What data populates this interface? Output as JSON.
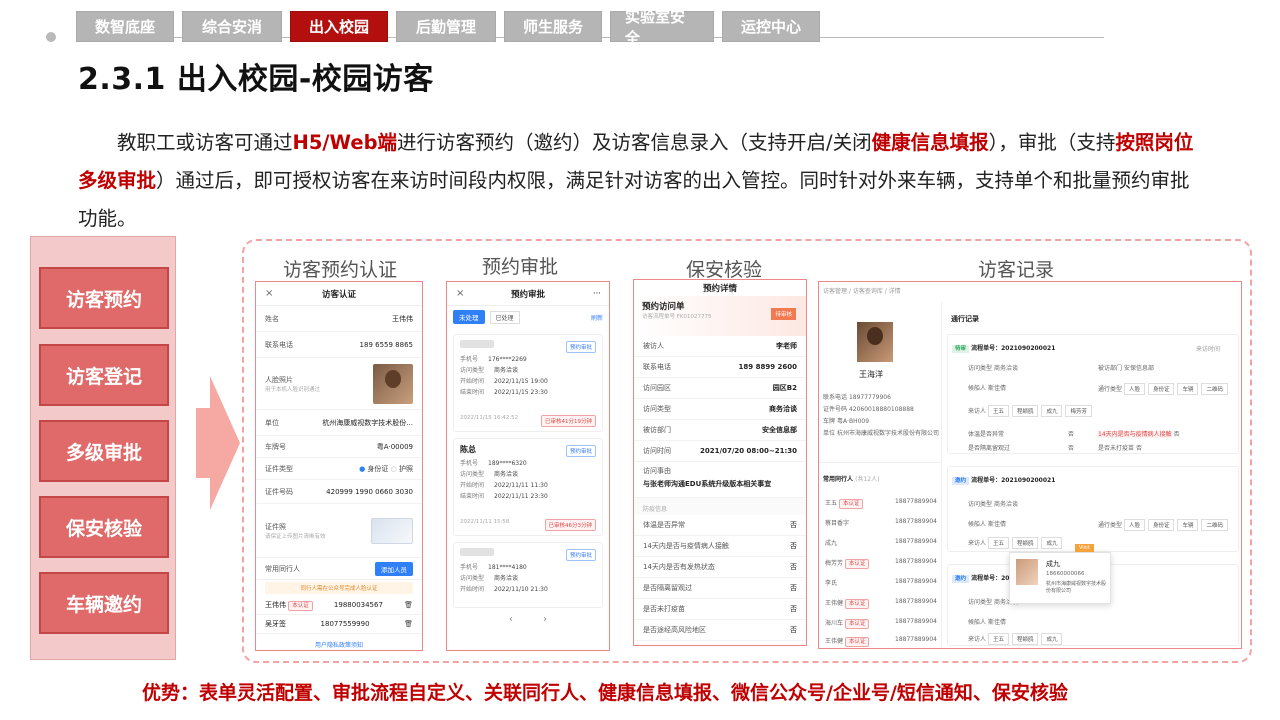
{
  "nav": {
    "tabs": [
      {
        "label": "数智底座",
        "active": false
      },
      {
        "label": "综合安消",
        "active": false
      },
      {
        "label": "出入校园",
        "active": true
      },
      {
        "label": "后勤管理",
        "active": false
      },
      {
        "label": "师生服务",
        "active": false
      },
      {
        "label": "实验室安全",
        "active": false
      },
      {
        "label": "运控中心",
        "active": false
      }
    ]
  },
  "page_title": "2.3.1 出入校园-校园访客",
  "intro": {
    "p1": "教职工或访客可通过",
    "h1": "H5/Web端",
    "p2": "进行访客预约（邀约）及访客信息录入（支持开启/关闭",
    "h2": "健康信息填报",
    "p3": "），审批（支持",
    "h3": "按照岗位多级审批",
    "p4": "）通过后，即可授权访客在来访时间段内权限，满足针对访客的出入管控。同时针对外来车辆，支持单个和批量预约审批功能。"
  },
  "sidebar": {
    "items": [
      "访客预约",
      "访客登记",
      "多级审批",
      "保安核验",
      "车辆邀约"
    ]
  },
  "columns": {
    "auth": "访客预约认证",
    "approval": "预约审批",
    "guard": "保安核验",
    "records": "访客记录"
  },
  "auth_card": {
    "header": "访客认证",
    "close": "×",
    "name_k": "姓名",
    "name_v": "王伟伟",
    "phone_k": "联系电话",
    "phone_v": "189 6559 8865",
    "face_k": "人脸照片",
    "face_sub": "用于本机人脸识别通过",
    "unit_k": "单位",
    "unit_v": "杭州海康威视数字技术股份...",
    "plate_k": "车牌号",
    "plate_v": "粤A·00009",
    "cert_k": "证件类型",
    "cert_opt1": "身份证",
    "cert_opt2": "护照",
    "certno_k": "证件号码",
    "certno_v": "420999 1990 0660 3030",
    "certimg_k": "证件照",
    "certimg_sub": "请保证上传图片清晰有效",
    "companions_k": "常用同行人",
    "add_btn": "添加人员",
    "notice": "同行人需在公众号完成人脸认证",
    "comp1_name": "王伟伟",
    "comp1_tag": "本认证",
    "comp1_phone": "19880034567",
    "comp2_name": "吴牙签",
    "comp2_phone": "18077559990",
    "footer_link": "用户隐私政策须知"
  },
  "approval_card": {
    "header": "预约审批",
    "more": "···",
    "filter_pending": "未处理",
    "filter_done": "已处理",
    "refresh": "刷新",
    "items": [
      {
        "name": "",
        "status": "预约审批",
        "phone": "176****2269",
        "type": "商务洽谈",
        "start": "2022/11/15 19:00",
        "end": "2022/11/15 23:30",
        "created": "2022/11/15 16:42:52",
        "remain": "已审核41分19分钟"
      },
      {
        "name": "陈总",
        "status": "预约审批",
        "phone": "189****6320",
        "type": "商务洽谈",
        "start": "2022/11/11 11:30",
        "end": "2022/11/11 23:30",
        "created": "2022/11/11 15:58",
        "remain": "已审核46分3分钟"
      },
      {
        "name": "",
        "status": "预约审批",
        "phone": "181****4180",
        "type": "商务洽谈",
        "start": "2022/11/10 21:30",
        "end": "",
        "created": "",
        "remain": ""
      }
    ],
    "labels": {
      "phone": "手机号",
      "type": "访问类型",
      "start": "开始时间",
      "end": "结束时间"
    },
    "prev": "‹",
    "next": "›"
  },
  "guard_card": {
    "header": "预约详情",
    "title": "预约访问单",
    "sub": "访客流程单号 FK01027775",
    "stamp": "待审核",
    "rows": [
      {
        "k": "被访人",
        "v": "李老师"
      },
      {
        "k": "联系电话",
        "v": "189 8899 2600"
      },
      {
        "k": "访问园区",
        "v": "园区B2"
      },
      {
        "k": "访问类型",
        "v": "商务洽谈"
      },
      {
        "k": "被访部门",
        "v": "安全信息部"
      },
      {
        "k": "访问时间",
        "v": "2021/07/20  08:00~21:30"
      }
    ],
    "reason_k": "访问事由",
    "reason_v": "与张老师沟通EDU系统升级版本相关事宜",
    "health_title": "防疫信息",
    "health": [
      {
        "k": "体温是否异常",
        "v": "否"
      },
      {
        "k": "14天内是否与疫情病人接触",
        "v": "否"
      },
      {
        "k": "14天内是否有发热状态",
        "v": "否"
      },
      {
        "k": "是否隔离留观过",
        "v": "否"
      },
      {
        "k": "是否未打疫苗",
        "v": "否"
      },
      {
        "k": "是否途经高风险地区",
        "v": "否"
      }
    ]
  },
  "records_card": {
    "breadcrumb": "访客管理 / 访客查询库 / 详情",
    "visitor_name": "王海洋",
    "visitor_fields": [
      {
        "k": "联系电话",
        "v": "18977779906"
      },
      {
        "k": "证件号码",
        "v": "42060018880108888"
      },
      {
        "k": "车牌",
        "v": "粤A·BH009"
      },
      {
        "k": "单位",
        "v": "杭州市海康威视数字技术股份有限公司"
      }
    ],
    "companions_title": "常用同行人",
    "companions_count": "(共12人)",
    "companions": [
      {
        "name": "王五",
        "tag": "本认证",
        "phone": "18877889904"
      },
      {
        "name": "蔡目香字",
        "tag": "",
        "phone": "18877889904"
      },
      {
        "name": "成九",
        "tag": "",
        "phone": "18877889904"
      },
      {
        "name": "梅芳芳",
        "tag": "本认证",
        "phone": "18877889904"
      },
      {
        "name": "李氏",
        "tag": "",
        "phone": "18877889904"
      },
      {
        "name": "王伟健",
        "tag": "本认证",
        "phone": "18877889904"
      },
      {
        "name": "海川车",
        "tag": "本认证",
        "phone": "18877889904"
      },
      {
        "name": "王伟健",
        "tag": "本认证",
        "phone": "18877889904"
      }
    ],
    "log_title": "通行记录",
    "flow1_badge": "待审",
    "flow1": "流程单号：2021090200021",
    "flow1_time": "来访时间",
    "flow2_badge": "邀约",
    "flow2": "流程单号：2021090200021",
    "flow3_badge": "邀约",
    "flow3": "流程单号：2021090200021",
    "type_k": "访问类型",
    "type_v": "商务洽谈",
    "dept_k": "被访部门",
    "dept_v": "安保信息部",
    "visitor_k": "候船人",
    "visitor_v": "斯佳倩",
    "passes_k": "通行类型",
    "passes": [
      "人脸",
      "身份证",
      "车辆",
      "二维码"
    ],
    "together_k": "来访人",
    "together": [
      "王五",
      "程颖鸥",
      "成九",
      "梅芳芳"
    ],
    "health1_k": "体温是否异常",
    "health1_v": "否",
    "health2_k": "是否隔离留观过",
    "health2_v": "否",
    "health3_k": "14天内是否与疫情病人接触",
    "health3_v": "否",
    "health4_k": "是否未打疫苗",
    "health4_v": "否",
    "popup_name": "成九",
    "popup_phone": "18660000066",
    "popup_unit": "杭州市海康威视数字技术股份有限公司",
    "popup_tag": "Visit"
  },
  "advantage": "优势：表单灵活配置、审批流程自定义、关联同行人、健康信息填报、微信公众号/企业号/短信通知、保安核验",
  "colors": {
    "accent": "#c00000",
    "nav_active": "#b40f0f",
    "nav_inactive": "#b5b5b5",
    "side_panel": "#f4c9c9",
    "side_button": "#e06a6a",
    "border_dashed": "#f2a3a3",
    "blue": "#2f7ff7"
  }
}
